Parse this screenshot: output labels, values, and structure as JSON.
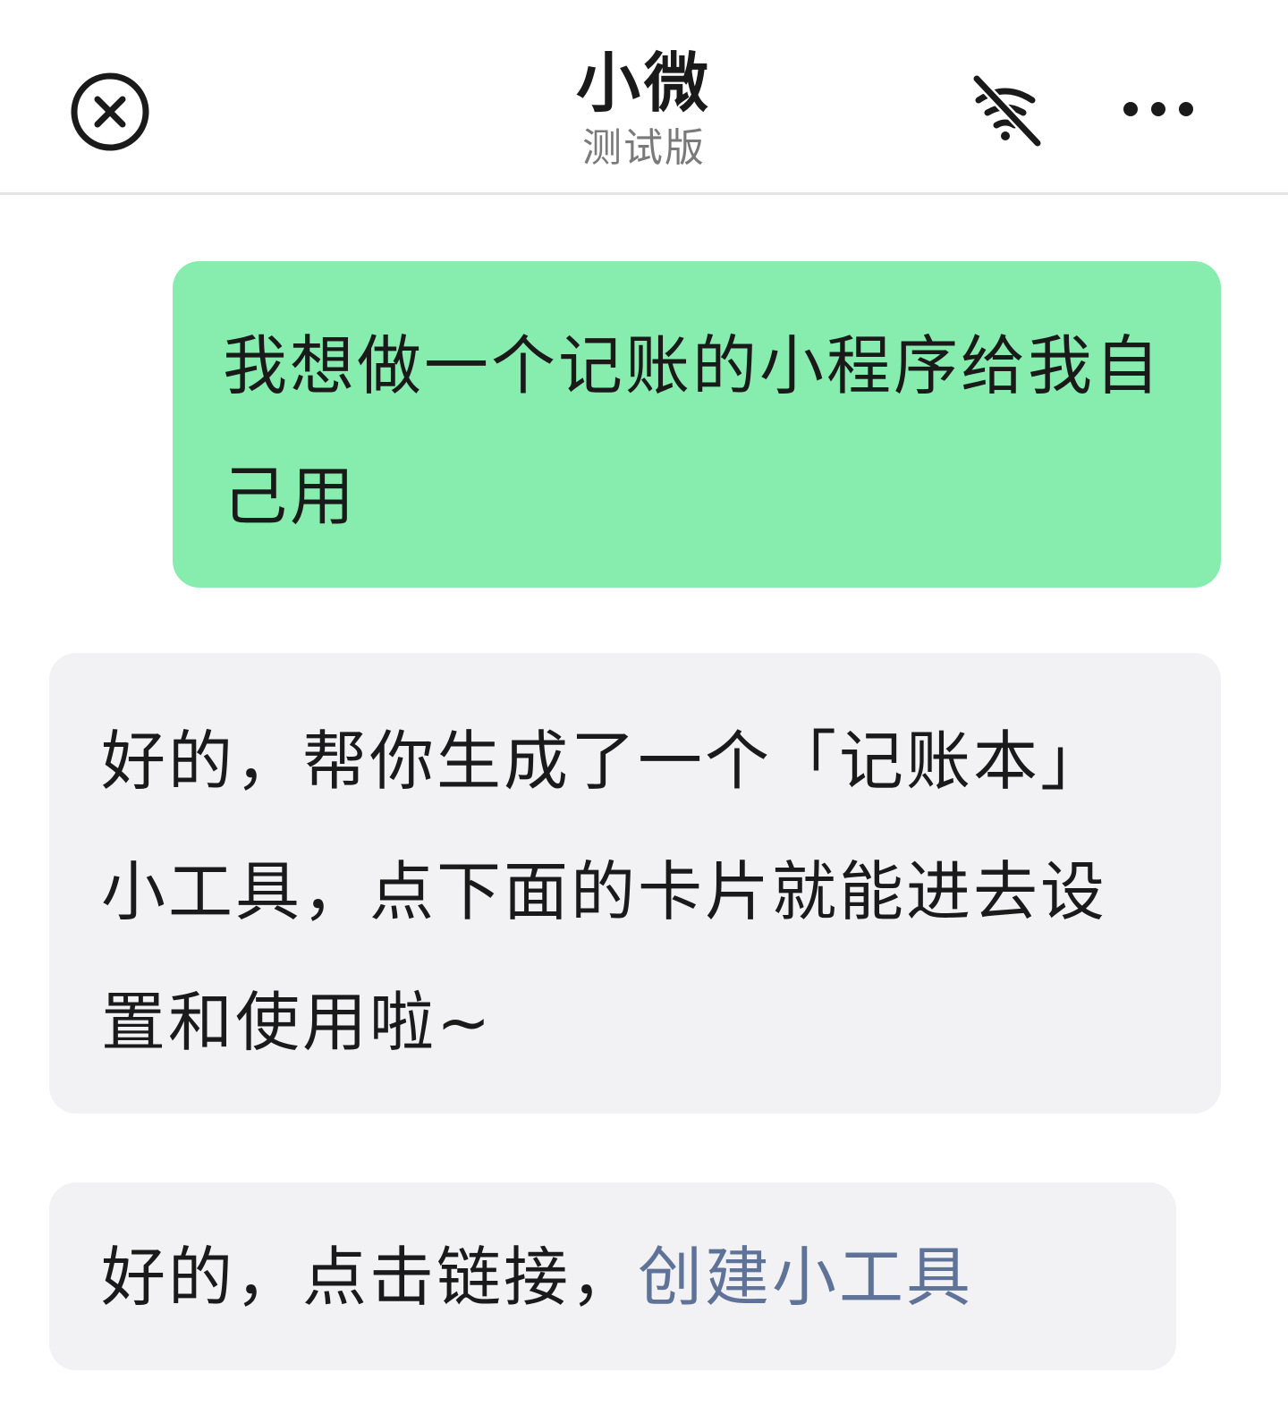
{
  "header": {
    "title": "小微",
    "subtitle": "测试版",
    "close_icon": "close-circle-icon",
    "mute_icon": "mute-bell-icon",
    "more_icon": "more-dots-icon"
  },
  "messages": [
    {
      "role": "user",
      "text": "我想做一个记账的小程序给我自己用",
      "bubble_color": "#86edae"
    },
    {
      "role": "assistant",
      "text": "好的，帮你生成了一个「记账本」小工具，点下面的卡片就能进去设置和使用啦~",
      "bubble_color": "#f2f2f5"
    },
    {
      "role": "assistant",
      "text": "好的，点击链接，",
      "link_text": "创建小工具",
      "link_color": "#5f7398",
      "bubble_color": "#f2f2f5"
    }
  ]
}
